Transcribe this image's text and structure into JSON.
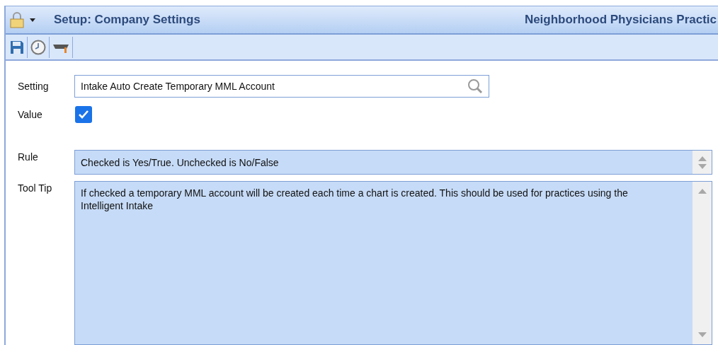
{
  "header": {
    "title": "Setup: Company Settings",
    "practice": "Neighborhood Physicians Practic"
  },
  "form": {
    "setting": {
      "label": "Setting",
      "value": "Intake Auto Create Temporary MML Account"
    },
    "value": {
      "label": "Value",
      "checked": true
    },
    "rule": {
      "label": "Rule",
      "text": "Checked is Yes/True. Unchecked is No/False"
    },
    "tooltip": {
      "label": "Tool Tip",
      "text": "If checked a temporary MML account will be created each time a chart is created. This should be used for practices using the Intelligent Intake"
    }
  }
}
